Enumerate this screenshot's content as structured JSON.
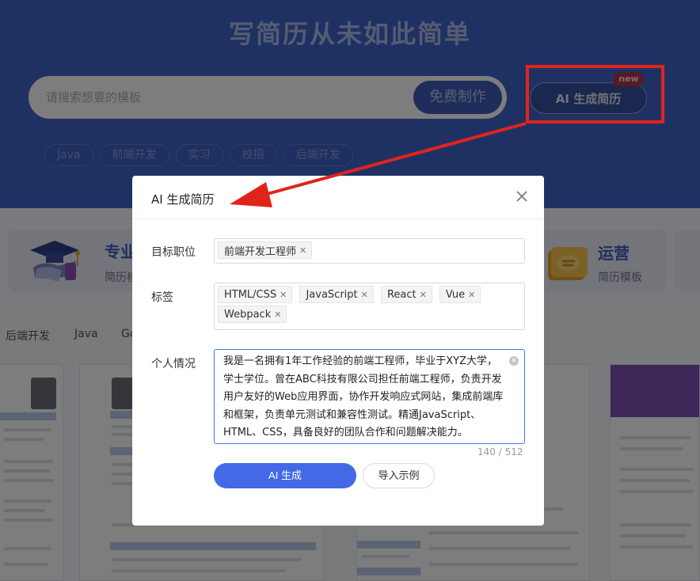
{
  "hero": {
    "title": "写简历从未如此简单",
    "search_placeholder": "请搜索想要的模板",
    "search_button": "免费制作",
    "ai_button": "AI 生成简历",
    "new_badge": "new",
    "tags": [
      "Java",
      "前端开发",
      "实习",
      "校招",
      "后端开发"
    ]
  },
  "categories": [
    {
      "title": "专业",
      "sub": "简历模",
      "icon": "graduation-cap-icon"
    },
    {
      "title": "运营",
      "sub": "简历模板",
      "icon": "megaphone-icon"
    }
  ],
  "filters": [
    "后端开发",
    "Java",
    "Go"
  ],
  "modal": {
    "title": "AI 生成简历",
    "position_label": "目标职位",
    "position_chip": "前端开发工程师",
    "tags_label": "标签",
    "tag_chips": [
      "HTML/CSS",
      "JavaScript",
      "React",
      "Vue",
      "Webpack"
    ],
    "profile_label": "个人情况",
    "profile_text": "我是一名拥有1年工作经验的前端工程师，毕业于XYZ大学，学士学位。曾在ABC科技有限公司担任前端工程师，负责开发用户友好的Web应用界面，协作开发响应式网站，集成前端库和框架，负责单元测试和兼容性测试。精通JavaScript、HTML、CSS，具备良好的团队合作和问题解决能力。",
    "counter": "140 / 512",
    "ai_generate_button": "AI 生成",
    "import_example_button": "导入示例"
  },
  "colors": {
    "hero_bg": "#3f63c6",
    "primary_button": "#4369e6",
    "annotation_red": "#e0241c",
    "badge": "#a8354a"
  }
}
